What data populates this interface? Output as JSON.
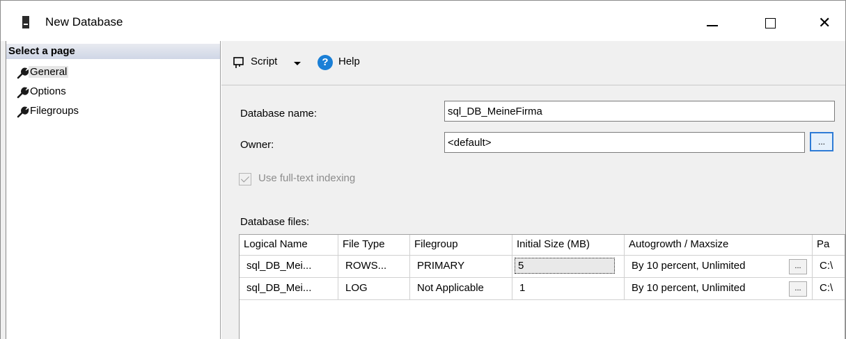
{
  "window": {
    "title": "New Database",
    "minimize_label": "—",
    "maximize_label": "",
    "close_label": "✕"
  },
  "left_pane": {
    "header": "Select a page",
    "items": [
      {
        "label": "General",
        "icon": "wrench-icon",
        "selected": true
      },
      {
        "label": "Options",
        "icon": "wrench-icon",
        "selected": false
      },
      {
        "label": "Filegroups",
        "icon": "wrench-icon",
        "selected": false
      }
    ]
  },
  "toolbar": {
    "script_label": "Script",
    "help_label": "Help",
    "help_icon_glyph": "?"
  },
  "form": {
    "database_name_label": "Database name:",
    "database_name_value": "sql_DB_MeineFirma",
    "owner_label": "Owner:",
    "owner_value": "<default>",
    "owner_browse_label": "...",
    "fulltext_label": "Use full-text indexing",
    "fulltext_checked": true,
    "fulltext_enabled": false
  },
  "files": {
    "section_label": "Database files:",
    "columns": [
      "Logical Name",
      "File Type",
      "Filegroup",
      "Initial Size (MB)",
      "Autogrowth / Maxsize",
      "Pa"
    ],
    "rows": [
      {
        "logical_name": "sql_DB_Mei...",
        "file_type": "ROWS...",
        "filegroup": "PRIMARY",
        "initial_size": "5",
        "autogrowth": "By 10 percent, Unlimited",
        "button": "...",
        "path": "C:\\"
      },
      {
        "logical_name": "sql_DB_Mei...",
        "file_type": "LOG",
        "filegroup": "Not Applicable",
        "initial_size": "1",
        "autogrowth": "By 10 percent, Unlimited",
        "button": "...",
        "path": "C:\\"
      }
    ]
  },
  "colors": {
    "accent": "#2e7bd6",
    "help_icon": "#1a7fd6",
    "pane_background": "#f0f0f0"
  }
}
